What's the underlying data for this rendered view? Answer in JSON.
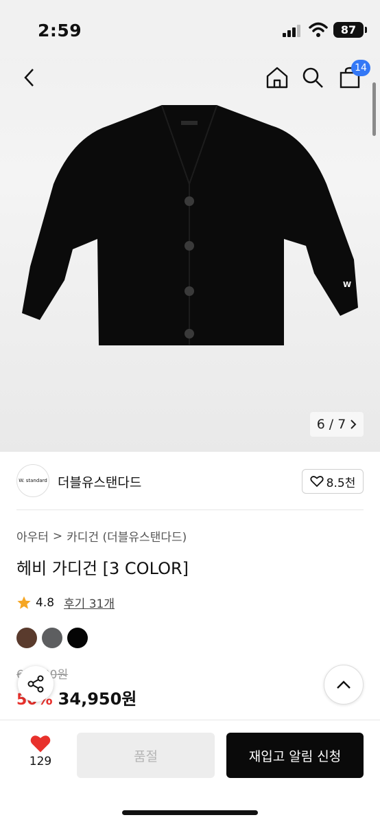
{
  "status": {
    "time": "2:59",
    "battery": "87"
  },
  "nav": {
    "cart_count": "14"
  },
  "gallery": {
    "current": "6",
    "separator": "/",
    "total": "7",
    "garment_mark": "W",
    "colors": {
      "garment": "#0b0b0b",
      "button": "#3a3a3a"
    }
  },
  "brand": {
    "logo_text": "W. standard",
    "name": "더블유스탠다드",
    "likes": "8.5천"
  },
  "breadcrumb": {
    "category": "아우터",
    "separator": ">",
    "subcategory": "카디건 (더블유스탠다드)"
  },
  "product": {
    "title": "헤비 가디건 [3 COLOR]",
    "rating": "4.8",
    "reviews": "후기 31개"
  },
  "swatches": [
    {
      "name": "brown",
      "color": "#5a3b2d"
    },
    {
      "name": "gray",
      "color": "#5d5e60"
    },
    {
      "name": "black",
      "color": "#050505"
    }
  ],
  "price": {
    "original": "69,900원",
    "discount": "50%",
    "sale": "34,950원"
  },
  "bottom": {
    "like_count": "129",
    "soldout_label": "품절",
    "restock_label": "재입고 알림 신청"
  },
  "colors": {
    "accent_red": "#e8312c",
    "badge_blue": "#3478f6",
    "star": "#f5a623"
  }
}
